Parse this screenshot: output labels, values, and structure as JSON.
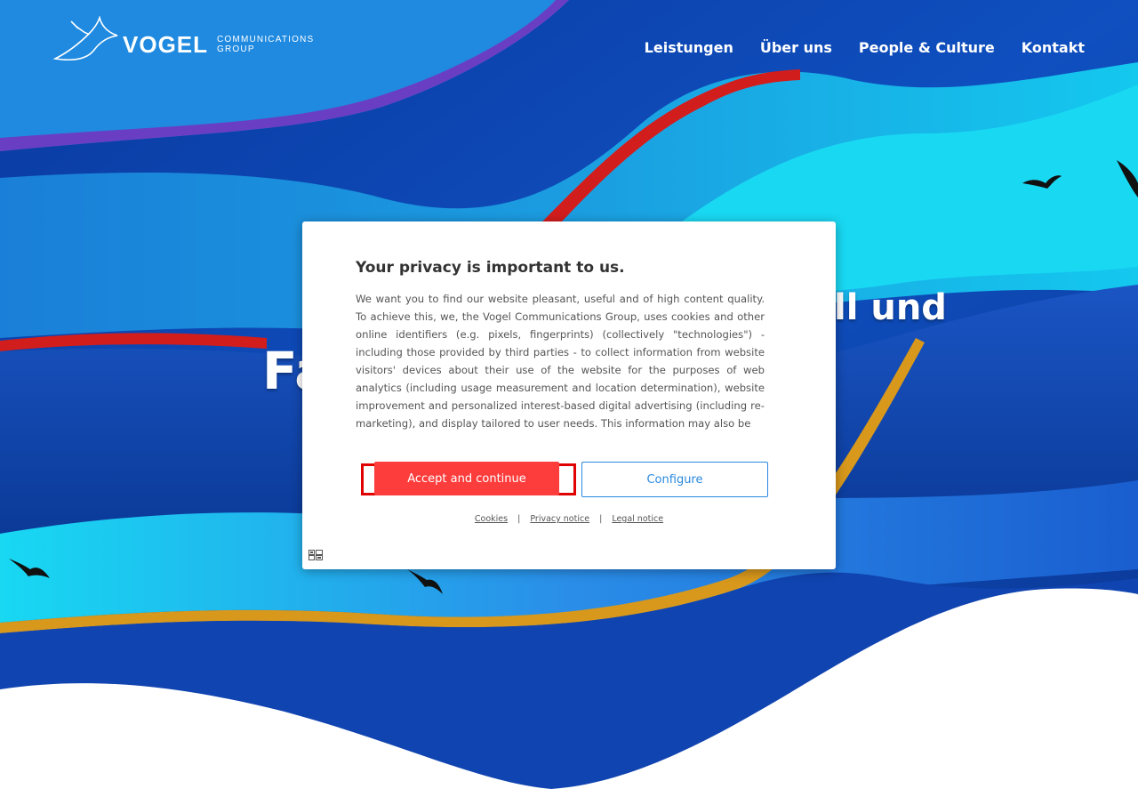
{
  "colors": {
    "deep_blue": "#0d3f9e",
    "mid_blue": "#1e6ed8",
    "cyan": "#19d3f0",
    "purple_ribbon": "#6b3bb8",
    "red_ribbon": "#d81c1c",
    "gold_ribbon": "#d89a1a",
    "accept_red": "#fd3c3c",
    "configure_blue": "#2a89e0"
  },
  "logo": {
    "wordmark": "VOGEL",
    "sub_line1": "COMMUNICATIONS",
    "sub_line2": "GROUP",
    "icon": "bird-logo-icon"
  },
  "nav": {
    "items": [
      {
        "label": "Leistungen"
      },
      {
        "label": "Über uns"
      },
      {
        "label": "People & Culture"
      },
      {
        "label": "Kontakt"
      }
    ]
  },
  "hero": {
    "partial_line1": "ll und",
    "partial_line2": "Fa"
  },
  "consent": {
    "title": "Your privacy is important to us.",
    "body": "We want you to find our website pleasant, useful and of high content quality. To achieve this, we, the Vogel Communications Group, uses cookies and other online identifiers (e.g. pixels, fingerprints) (collectively \"technologies\") - including those provided by third parties - to collect information from website visitors' devices about their use of the website for the purposes of web analytics (including usage measurement and location determination), website improvement and personalized interest-based digital advertising (including re-marketing), and display tailored to user needs. This information may also be",
    "accept_label": "Accept and continue",
    "configure_label": "Configure",
    "links": {
      "cookies": "Cookies",
      "privacy": "Privacy notice",
      "legal": "Legal notice",
      "separator": "|"
    },
    "footer_icon": "consent-settings-icon"
  }
}
